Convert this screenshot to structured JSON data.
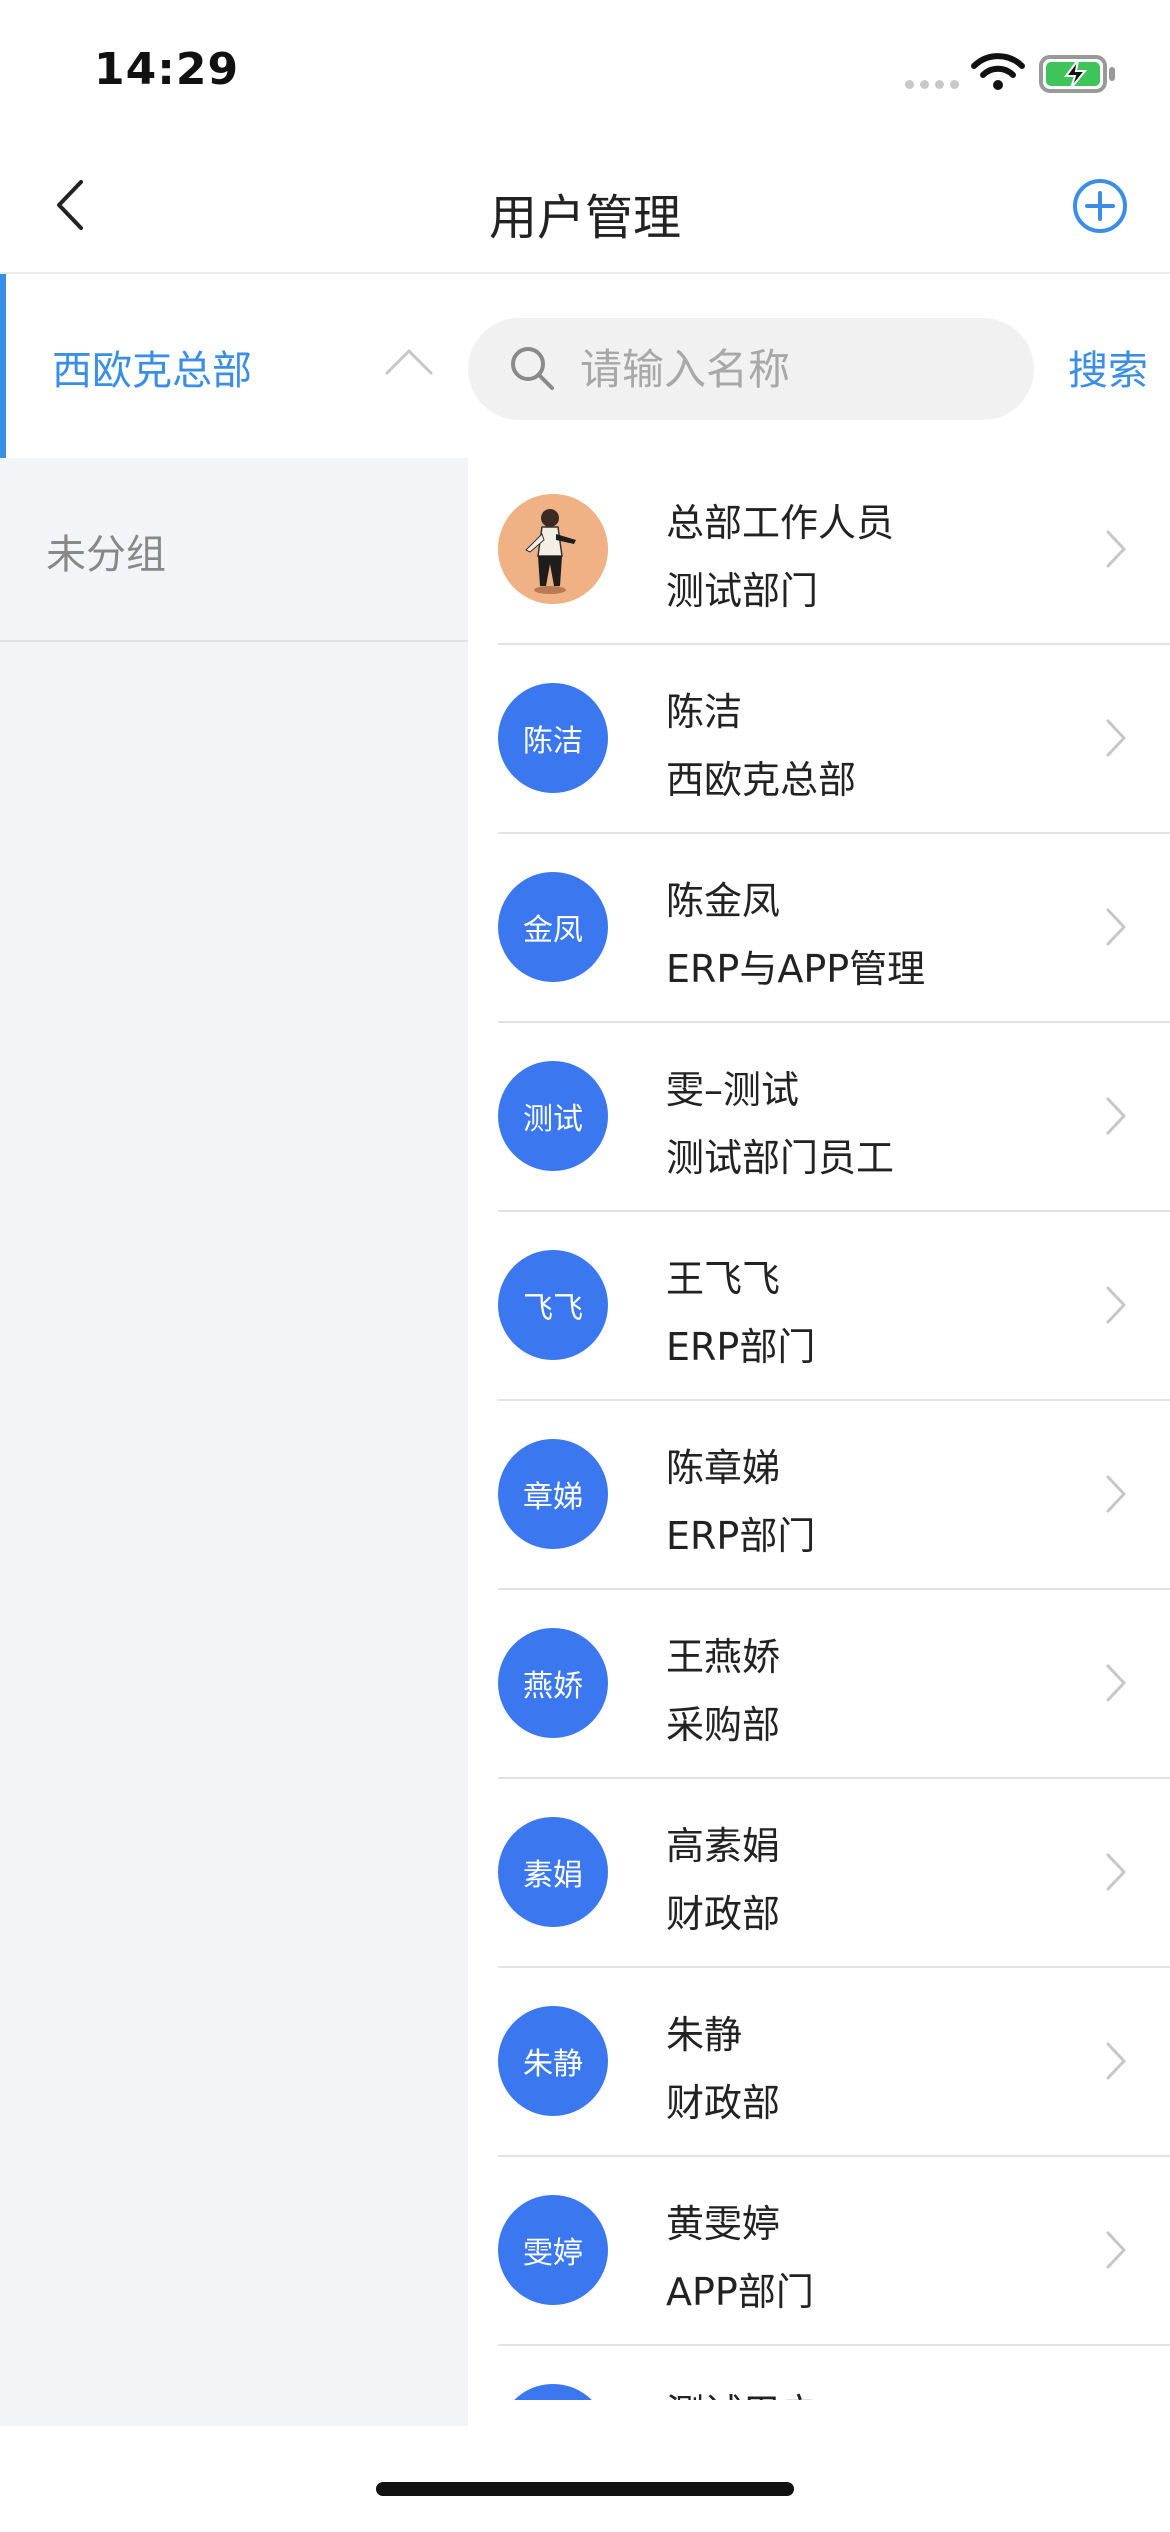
{
  "status_bar": {
    "time": "14:29"
  },
  "nav": {
    "title": "用户管理",
    "back_icon": "chevron-left-icon",
    "add_icon": "plus-circle-icon"
  },
  "groups": [
    {
      "label": "西欧克总部",
      "active": true
    },
    {
      "label": "未分组",
      "active": false
    }
  ],
  "search": {
    "placeholder": "请输入名称",
    "value": "",
    "button_label": "搜索"
  },
  "users": [
    {
      "avatar": "",
      "avatar_type": "photo",
      "name": "总部工作人员",
      "dept": "测试部门"
    },
    {
      "avatar": "陈洁",
      "avatar_type": "text",
      "name": "陈洁",
      "dept": "西欧克总部"
    },
    {
      "avatar": "金凤",
      "avatar_type": "text",
      "name": "陈金凤",
      "dept": "ERP与APP管理"
    },
    {
      "avatar": "测试",
      "avatar_type": "text",
      "name": "雯–测试",
      "dept": "测试部门员工"
    },
    {
      "avatar": "飞飞",
      "avatar_type": "text",
      "name": "王飞飞",
      "dept": "ERP部门"
    },
    {
      "avatar": "章娣",
      "avatar_type": "text",
      "name": "陈章娣",
      "dept": "ERP部门"
    },
    {
      "avatar": "燕娇",
      "avatar_type": "text",
      "name": "王燕娇",
      "dept": "采购部"
    },
    {
      "avatar": "素娟",
      "avatar_type": "text",
      "name": "高素娟",
      "dept": "财政部"
    },
    {
      "avatar": "朱静",
      "avatar_type": "text",
      "name": "朱静",
      "dept": "财政部"
    },
    {
      "avatar": "雯婷",
      "avatar_type": "text",
      "name": "黄雯婷",
      "dept": "APP部门"
    },
    {
      "avatar": "",
      "avatar_type": "text",
      "name": "测试用户",
      "dept": ""
    }
  ],
  "colors": {
    "accent": "#3a8ee6",
    "avatar_bg": "#3b78f0",
    "sidebar_bg": "#f3f4f8"
  }
}
